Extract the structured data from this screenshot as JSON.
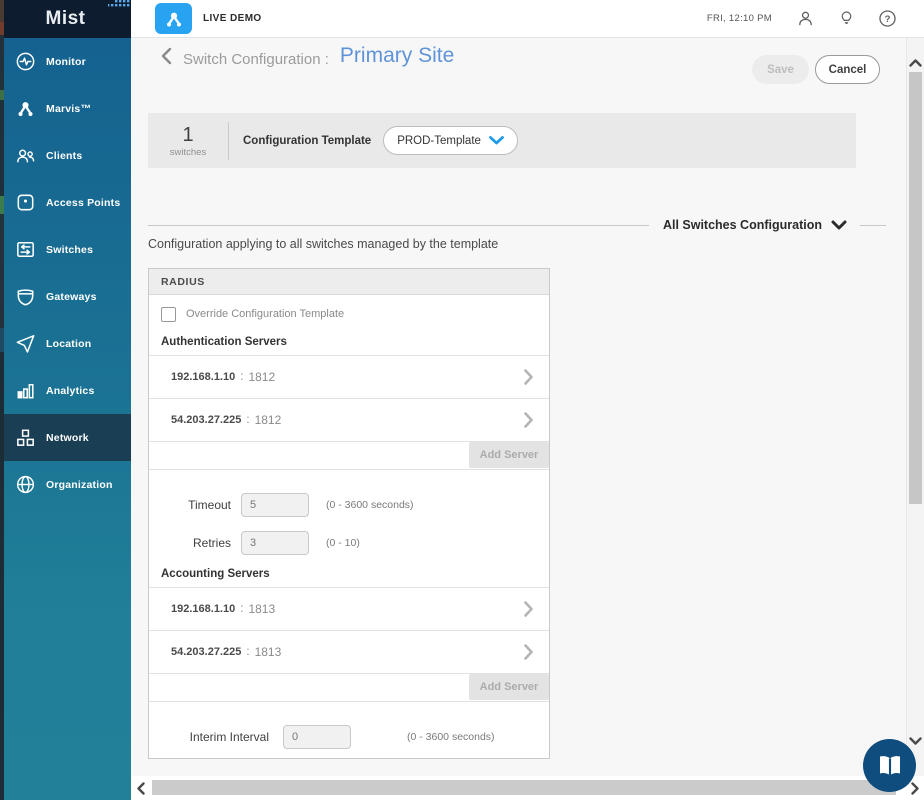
{
  "colors": {
    "accent_blue": "#1E9BE9",
    "title_blue": "#5F93D8",
    "sidebar_selected": "#1A3E53",
    "logo_bg": "#0D1C2E",
    "org_badge_blue": "#27A3F2",
    "book_navy": "#0F4D7E"
  },
  "brand": {
    "logo_text": "Mist"
  },
  "topbar": {
    "org_label": "LIVE DEMO",
    "time": "FRI, 12:10 PM",
    "icons": [
      "user-icon",
      "bulb-icon",
      "help-icon"
    ]
  },
  "sidebar": {
    "items": [
      {
        "label": "Monitor",
        "icon": "monitor-icon"
      },
      {
        "label": "Marvis™",
        "icon": "marvis-icon"
      },
      {
        "label": "Clients",
        "icon": "clients-icon"
      },
      {
        "label": "Access Points",
        "icon": "access-points-icon"
      },
      {
        "label": "Switches",
        "icon": "switches-icon"
      },
      {
        "label": "Gateways",
        "icon": "gateways-icon"
      },
      {
        "label": "Location",
        "icon": "location-icon"
      },
      {
        "label": "Analytics",
        "icon": "analytics-icon"
      },
      {
        "label": "Network",
        "icon": "network-icon",
        "selected": true
      },
      {
        "label": "Organization",
        "icon": "organization-icon"
      }
    ]
  },
  "header": {
    "title_prefix": "Switch Configuration :",
    "site_name": "Primary Site",
    "save_label": "Save",
    "cancel_label": "Cancel"
  },
  "template_bar": {
    "count": "1",
    "count_label": "switches",
    "field_label": "Configuration Template",
    "selected_template": "PROD-Template"
  },
  "section": {
    "title": "All Switches Configuration",
    "description": "Configuration applying to all switches managed by the template"
  },
  "radius": {
    "panel_title": "RADIUS",
    "override_label": "Override Configuration Template",
    "override_checked": false,
    "sep": ":",
    "auth_heading": "Authentication Servers",
    "auth_servers": [
      {
        "ip": "192.168.1.10",
        "port": "1812"
      },
      {
        "ip": "54.203.27.225",
        "port": "1812"
      }
    ],
    "add_server_label": "Add Server",
    "timeout": {
      "label": "Timeout",
      "value": "5",
      "hint": "(0 - 3600 seconds)"
    },
    "retries": {
      "label": "Retries",
      "value": "3",
      "hint": "(0 - 10)"
    },
    "acct_heading": "Accounting Servers",
    "acct_servers": [
      {
        "ip": "192.168.1.10",
        "port": "1813"
      },
      {
        "ip": "54.203.27.225",
        "port": "1813"
      }
    ],
    "interim": {
      "label": "Interim Interval",
      "value": "0",
      "hint": "(0 - 3600 seconds)"
    }
  }
}
